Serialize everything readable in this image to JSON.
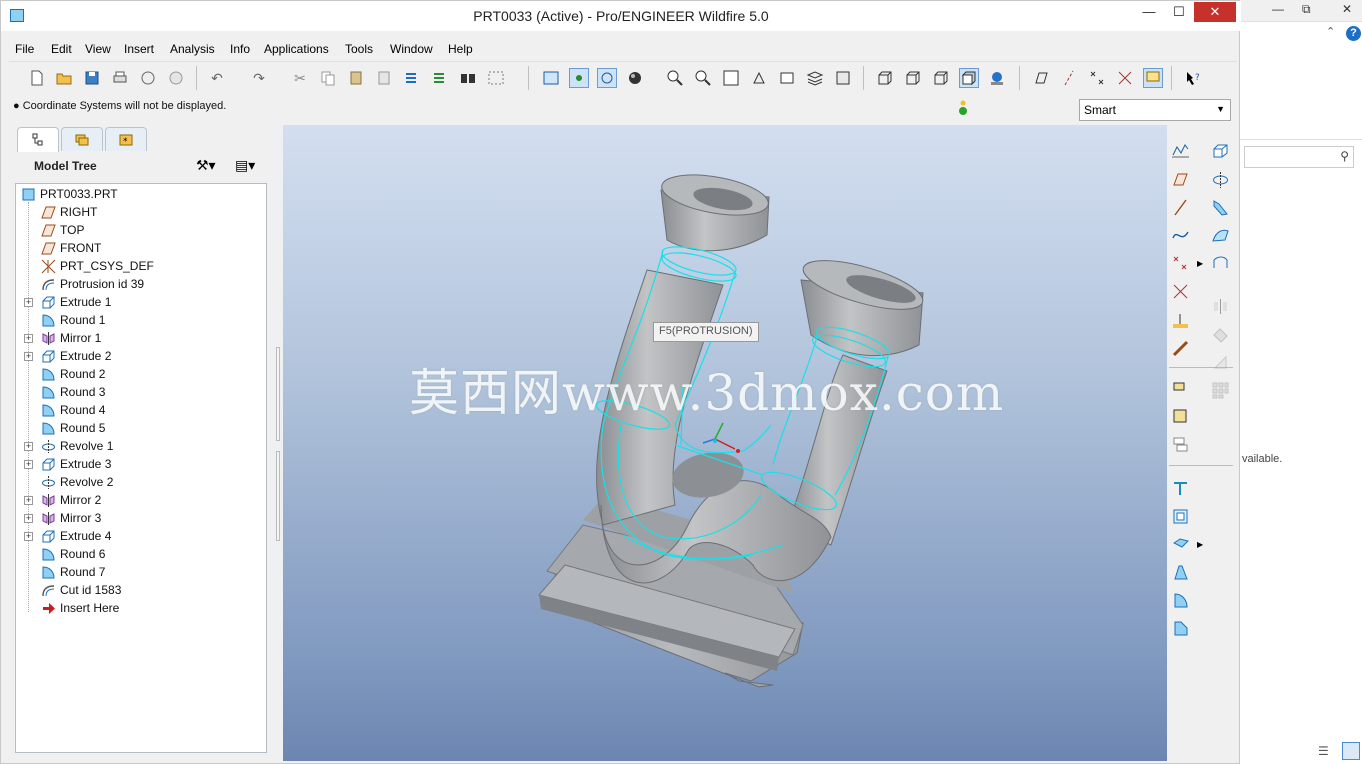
{
  "window": {
    "title": "PRT0033 (Active) - Pro/ENGINEER Wildfire 5.0",
    "minimize": "—",
    "maximize": "☐",
    "close": "✕"
  },
  "menu": [
    "File",
    "Edit",
    "View",
    "Insert",
    "Analysis",
    "Info",
    "Applications",
    "Tools",
    "Window",
    "Help"
  ],
  "message": "Coordinate Systems will not be displayed.",
  "filter": {
    "value": "Smart"
  },
  "model_tree": {
    "title": "Model Tree",
    "root": "PRT0033.PRT",
    "items": [
      {
        "label": "RIGHT",
        "icon": "datum-plane-icon",
        "expand": false
      },
      {
        "label": "TOP",
        "icon": "datum-plane-icon",
        "expand": false
      },
      {
        "label": "FRONT",
        "icon": "datum-plane-icon",
        "expand": false
      },
      {
        "label": "PRT_CSYS_DEF",
        "icon": "csys-icon",
        "expand": false
      },
      {
        "label": "Protrusion id 39",
        "icon": "protrusion-icon",
        "expand": false
      },
      {
        "label": "Extrude 1",
        "icon": "extrude-icon",
        "expand": true
      },
      {
        "label": "Round 1",
        "icon": "round-icon",
        "expand": false
      },
      {
        "label": "Mirror 1",
        "icon": "mirror-icon",
        "expand": true
      },
      {
        "label": "Extrude 2",
        "icon": "extrude-icon",
        "expand": true
      },
      {
        "label": "Round 2",
        "icon": "round-icon",
        "expand": false
      },
      {
        "label": "Round 3",
        "icon": "round-icon",
        "expand": false
      },
      {
        "label": "Round 4",
        "icon": "round-icon",
        "expand": false
      },
      {
        "label": "Round 5",
        "icon": "round-icon",
        "expand": false
      },
      {
        "label": "Revolve 1",
        "icon": "revolve-icon",
        "expand": true
      },
      {
        "label": "Extrude 3",
        "icon": "extrude-icon",
        "expand": true
      },
      {
        "label": "Revolve 2",
        "icon": "revolve-icon",
        "expand": false
      },
      {
        "label": "Mirror 2",
        "icon": "mirror-icon",
        "expand": true
      },
      {
        "label": "Mirror 3",
        "icon": "mirror-icon",
        "expand": true
      },
      {
        "label": "Extrude 4",
        "icon": "extrude-icon",
        "expand": true
      },
      {
        "label": "Round 6",
        "icon": "round-icon",
        "expand": false
      },
      {
        "label": "Round 7",
        "icon": "round-icon",
        "expand": false
      },
      {
        "label": "Cut id 1583",
        "icon": "cut-icon",
        "expand": false
      },
      {
        "label": "Insert Here",
        "icon": "insert-arrow-icon",
        "expand": false
      }
    ]
  },
  "viewport": {
    "watermark": "莫西网www.3dmox.com",
    "tooltip": "F5(PROTRUSION)"
  },
  "side_panel": {
    "text": "vailable."
  },
  "colors": {
    "highlight": "#18e0e8",
    "model": "#a6a9ad",
    "viewport_top": "#d3dff0",
    "viewport_bottom": "#6c86b1"
  }
}
